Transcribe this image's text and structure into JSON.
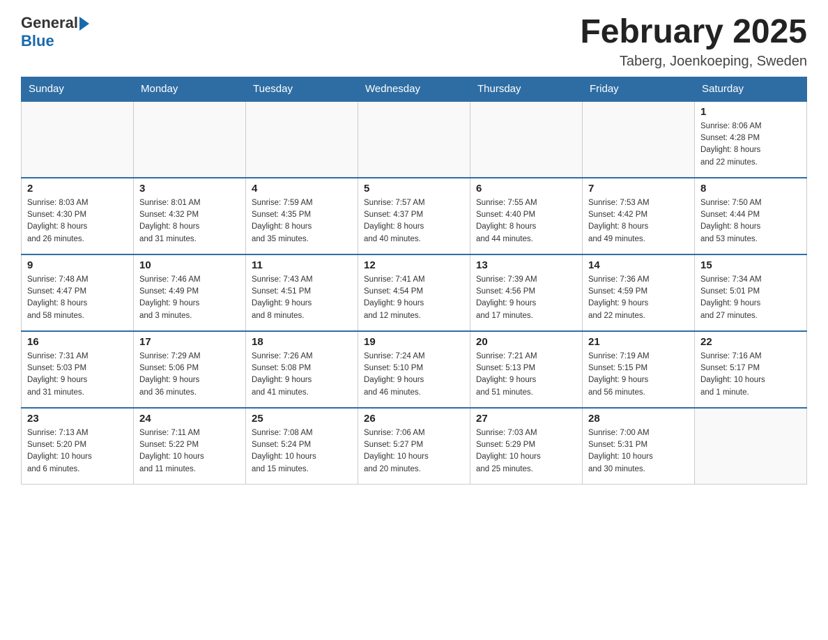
{
  "header": {
    "logo_general": "General",
    "logo_blue": "Blue",
    "title": "February 2025",
    "subtitle": "Taberg, Joenkoeping, Sweden"
  },
  "days_of_week": [
    "Sunday",
    "Monday",
    "Tuesday",
    "Wednesday",
    "Thursday",
    "Friday",
    "Saturday"
  ],
  "weeks": [
    [
      {
        "day": "",
        "info": ""
      },
      {
        "day": "",
        "info": ""
      },
      {
        "day": "",
        "info": ""
      },
      {
        "day": "",
        "info": ""
      },
      {
        "day": "",
        "info": ""
      },
      {
        "day": "",
        "info": ""
      },
      {
        "day": "1",
        "info": "Sunrise: 8:06 AM\nSunset: 4:28 PM\nDaylight: 8 hours\nand 22 minutes."
      }
    ],
    [
      {
        "day": "2",
        "info": "Sunrise: 8:03 AM\nSunset: 4:30 PM\nDaylight: 8 hours\nand 26 minutes."
      },
      {
        "day": "3",
        "info": "Sunrise: 8:01 AM\nSunset: 4:32 PM\nDaylight: 8 hours\nand 31 minutes."
      },
      {
        "day": "4",
        "info": "Sunrise: 7:59 AM\nSunset: 4:35 PM\nDaylight: 8 hours\nand 35 minutes."
      },
      {
        "day": "5",
        "info": "Sunrise: 7:57 AM\nSunset: 4:37 PM\nDaylight: 8 hours\nand 40 minutes."
      },
      {
        "day": "6",
        "info": "Sunrise: 7:55 AM\nSunset: 4:40 PM\nDaylight: 8 hours\nand 44 minutes."
      },
      {
        "day": "7",
        "info": "Sunrise: 7:53 AM\nSunset: 4:42 PM\nDaylight: 8 hours\nand 49 minutes."
      },
      {
        "day": "8",
        "info": "Sunrise: 7:50 AM\nSunset: 4:44 PM\nDaylight: 8 hours\nand 53 minutes."
      }
    ],
    [
      {
        "day": "9",
        "info": "Sunrise: 7:48 AM\nSunset: 4:47 PM\nDaylight: 8 hours\nand 58 minutes."
      },
      {
        "day": "10",
        "info": "Sunrise: 7:46 AM\nSunset: 4:49 PM\nDaylight: 9 hours\nand 3 minutes."
      },
      {
        "day": "11",
        "info": "Sunrise: 7:43 AM\nSunset: 4:51 PM\nDaylight: 9 hours\nand 8 minutes."
      },
      {
        "day": "12",
        "info": "Sunrise: 7:41 AM\nSunset: 4:54 PM\nDaylight: 9 hours\nand 12 minutes."
      },
      {
        "day": "13",
        "info": "Sunrise: 7:39 AM\nSunset: 4:56 PM\nDaylight: 9 hours\nand 17 minutes."
      },
      {
        "day": "14",
        "info": "Sunrise: 7:36 AM\nSunset: 4:59 PM\nDaylight: 9 hours\nand 22 minutes."
      },
      {
        "day": "15",
        "info": "Sunrise: 7:34 AM\nSunset: 5:01 PM\nDaylight: 9 hours\nand 27 minutes."
      }
    ],
    [
      {
        "day": "16",
        "info": "Sunrise: 7:31 AM\nSunset: 5:03 PM\nDaylight: 9 hours\nand 31 minutes."
      },
      {
        "day": "17",
        "info": "Sunrise: 7:29 AM\nSunset: 5:06 PM\nDaylight: 9 hours\nand 36 minutes."
      },
      {
        "day": "18",
        "info": "Sunrise: 7:26 AM\nSunset: 5:08 PM\nDaylight: 9 hours\nand 41 minutes."
      },
      {
        "day": "19",
        "info": "Sunrise: 7:24 AM\nSunset: 5:10 PM\nDaylight: 9 hours\nand 46 minutes."
      },
      {
        "day": "20",
        "info": "Sunrise: 7:21 AM\nSunset: 5:13 PM\nDaylight: 9 hours\nand 51 minutes."
      },
      {
        "day": "21",
        "info": "Sunrise: 7:19 AM\nSunset: 5:15 PM\nDaylight: 9 hours\nand 56 minutes."
      },
      {
        "day": "22",
        "info": "Sunrise: 7:16 AM\nSunset: 5:17 PM\nDaylight: 10 hours\nand 1 minute."
      }
    ],
    [
      {
        "day": "23",
        "info": "Sunrise: 7:13 AM\nSunset: 5:20 PM\nDaylight: 10 hours\nand 6 minutes."
      },
      {
        "day": "24",
        "info": "Sunrise: 7:11 AM\nSunset: 5:22 PM\nDaylight: 10 hours\nand 11 minutes."
      },
      {
        "day": "25",
        "info": "Sunrise: 7:08 AM\nSunset: 5:24 PM\nDaylight: 10 hours\nand 15 minutes."
      },
      {
        "day": "26",
        "info": "Sunrise: 7:06 AM\nSunset: 5:27 PM\nDaylight: 10 hours\nand 20 minutes."
      },
      {
        "day": "27",
        "info": "Sunrise: 7:03 AM\nSunset: 5:29 PM\nDaylight: 10 hours\nand 25 minutes."
      },
      {
        "day": "28",
        "info": "Sunrise: 7:00 AM\nSunset: 5:31 PM\nDaylight: 10 hours\nand 30 minutes."
      },
      {
        "day": "",
        "info": ""
      }
    ]
  ]
}
